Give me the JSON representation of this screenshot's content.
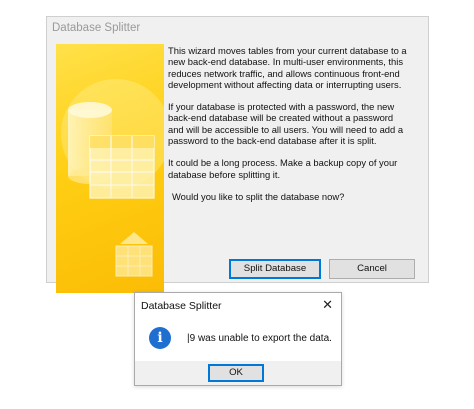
{
  "wizard": {
    "title": "Database Splitter",
    "paragraphs": [
      "This wizard moves tables from your current database to a new back-end database. In multi-user environments, this reduces network traffic, and allows continuous front-end development without affecting data or interrupting users.",
      "If your database is protected with a password, the new back-end database will be created without a password and will be accessible to all users.  You will need to add a password to the back-end database after it is split.",
      "It could be a long process. Make a backup copy of your database before splitting it.",
      "Would you like to split the database now?"
    ],
    "split_button": "Split Database",
    "cancel_button": "Cancel"
  },
  "message_box": {
    "title": "Database Splitter",
    "close_glyph": "✕",
    "icon": "info-icon",
    "icon_glyph": "i",
    "message": "|9 was unable to export the data.",
    "ok_button": "OK"
  },
  "colors": {
    "accent": "#0078d7",
    "art_yellow": "#ffcf14",
    "info_blue": "#1e6fd0"
  }
}
